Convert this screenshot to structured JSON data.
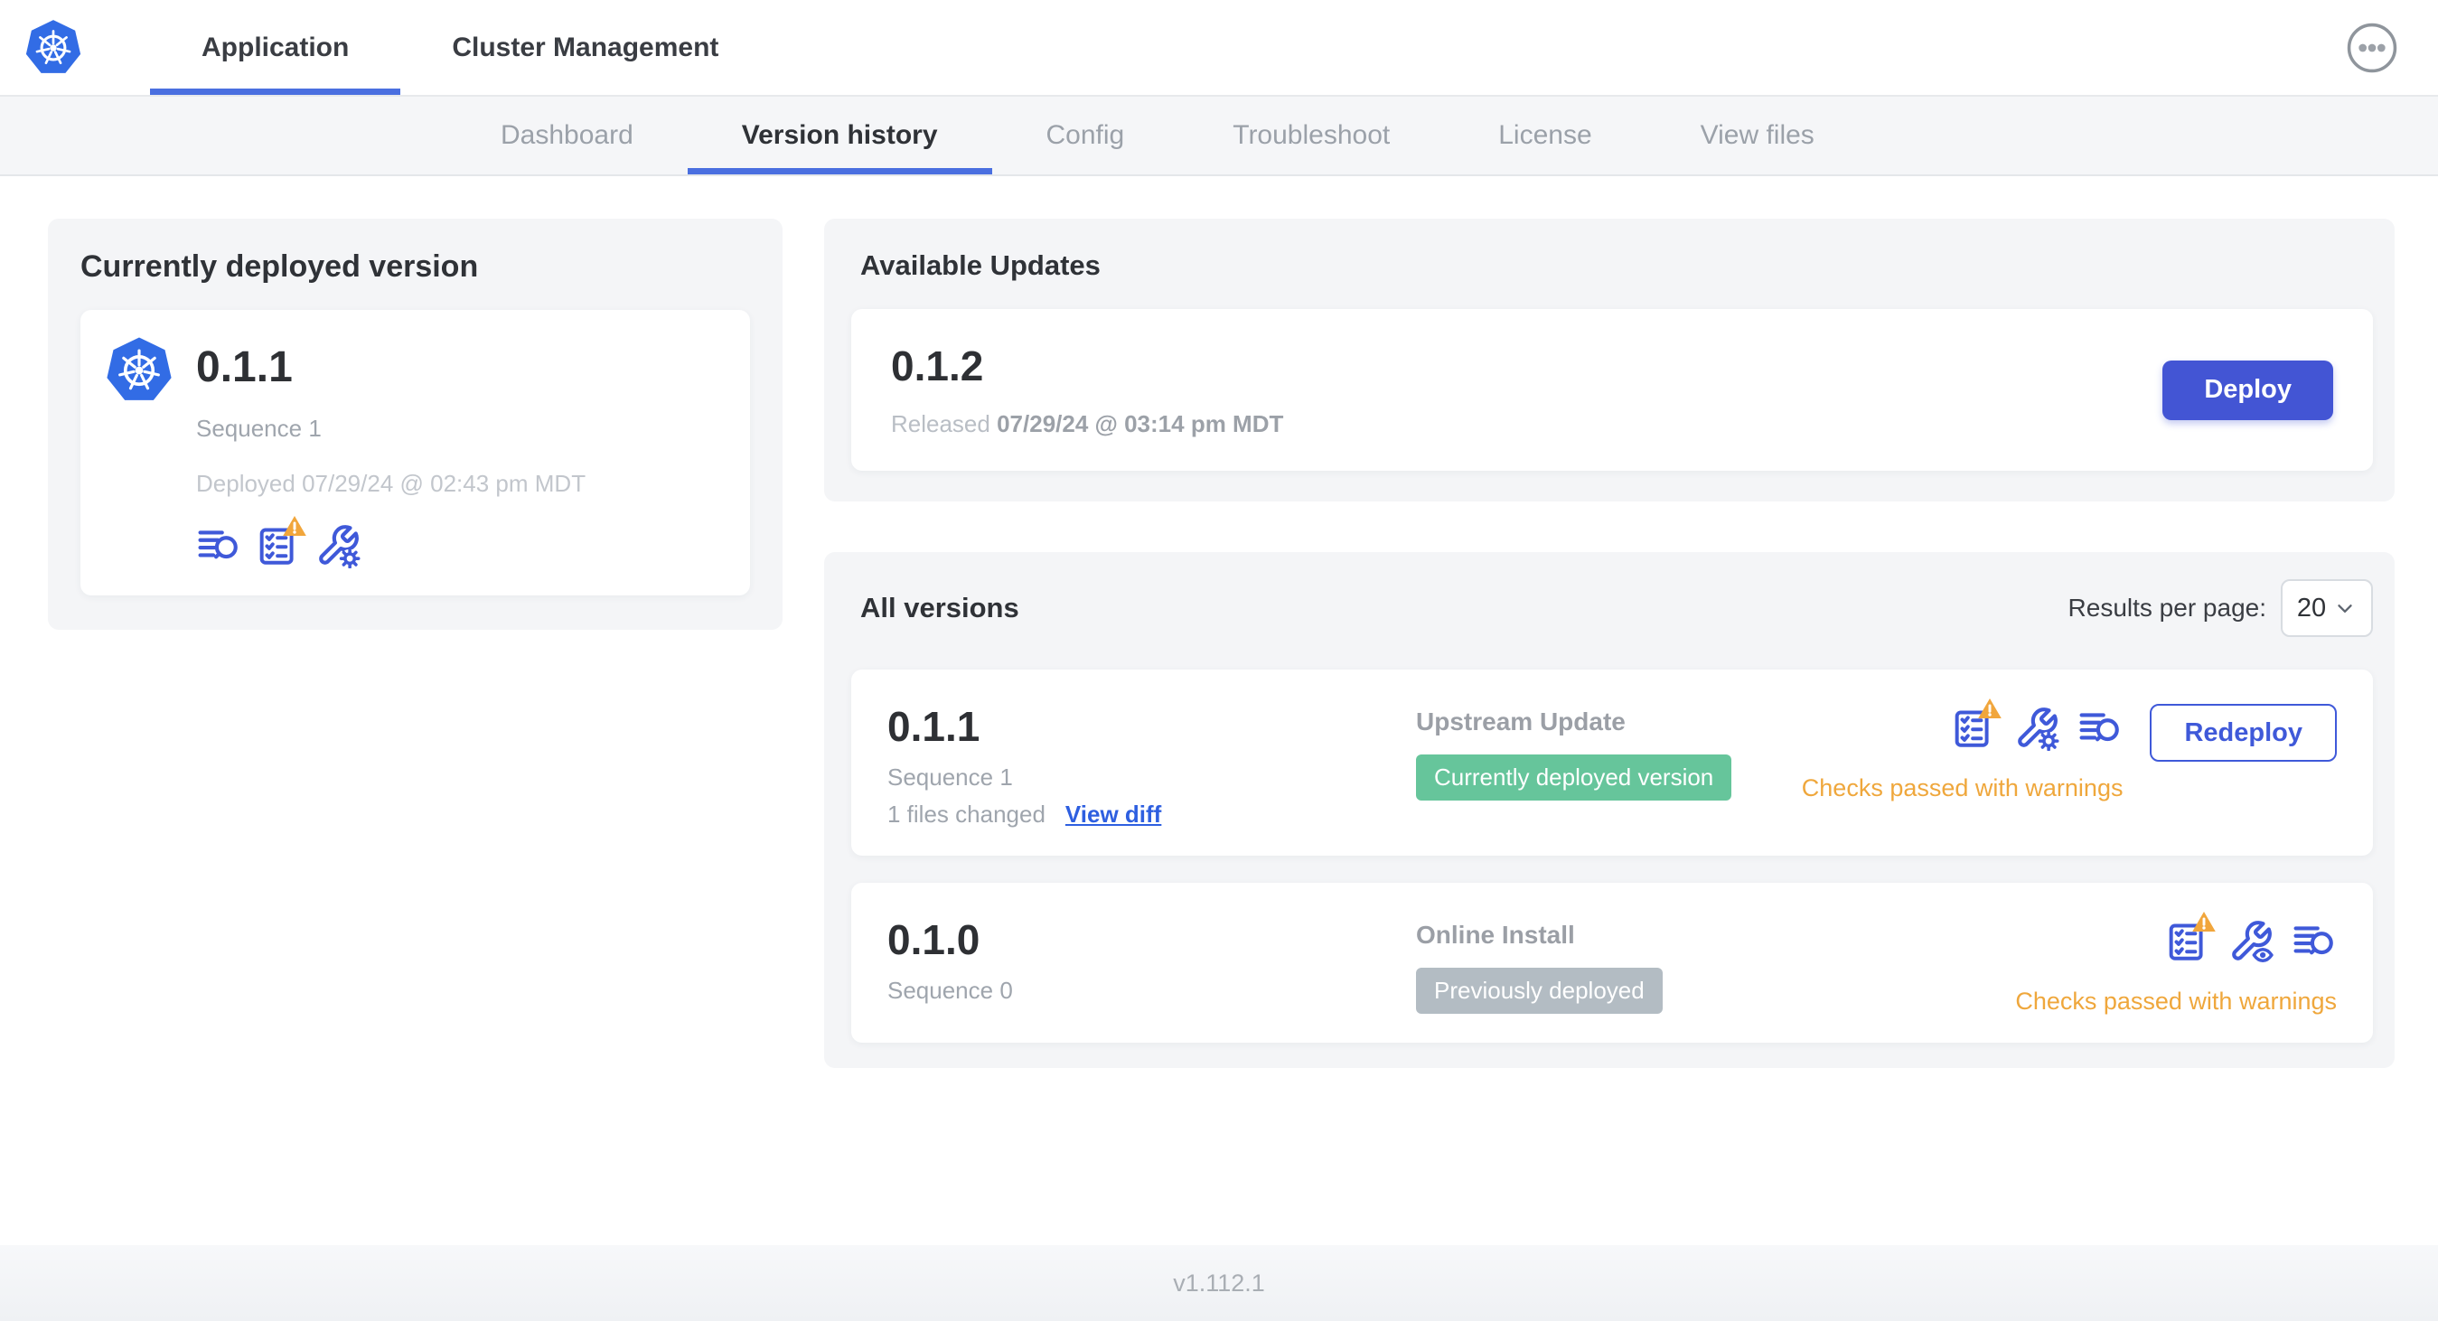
{
  "topnav": {
    "tabs": [
      {
        "label": "Application"
      },
      {
        "label": "Cluster Management"
      }
    ]
  },
  "subnav": {
    "tabs": [
      {
        "label": "Dashboard"
      },
      {
        "label": "Version history"
      },
      {
        "label": "Config"
      },
      {
        "label": "Troubleshoot"
      },
      {
        "label": "License"
      },
      {
        "label": "View files"
      }
    ]
  },
  "current": {
    "title": "Currently deployed version",
    "version": "0.1.1",
    "sequence": "Sequence 1",
    "deployed": "Deployed 07/29/24 @ 02:43 pm MDT",
    "icons": [
      "diff-lines-search-icon",
      "preflight-checklist-warning-icon",
      "wrench-gear-config-icon"
    ]
  },
  "available": {
    "title": "Available Updates",
    "version": "0.1.2",
    "released_prefix": "Released",
    "released_date": "07/29/24 @ 03:14 pm MDT",
    "deploy_label": "Deploy"
  },
  "all_versions": {
    "title": "All versions",
    "results_per_page_label": "Results per page:",
    "results_per_page_value": "20",
    "rows": [
      {
        "version": "0.1.1",
        "sequence": "Sequence 1",
        "files_changed": "1 files changed",
        "view_diff_label": "View diff",
        "source": "Upstream Update",
        "badge": "Currently deployed version",
        "badge_type": "success",
        "icons": [
          "preflight-checklist-warning-icon",
          "wrench-gear-config-icon",
          "diff-lines-search-icon"
        ],
        "action_label": "Redeploy",
        "status": "Checks passed with warnings"
      },
      {
        "version": "0.1.0",
        "sequence": "Sequence 0",
        "source": "Online Install",
        "badge": "Previously deployed",
        "badge_type": "muted",
        "icons": [
          "preflight-checklist-warning-icon",
          "wrench-eye-view-config-icon",
          "diff-lines-search-icon"
        ],
        "status": "Checks passed with warnings"
      }
    ]
  },
  "footer": {
    "app_version": "v1.112.1"
  },
  "colors": {
    "kubernetes_blue": "#326CE5",
    "primary_button_blue": "#4355D4",
    "icon_blue": "#3F59D9",
    "link_blue": "#2E5FE0",
    "active_tab_underline": "#4A6FE0",
    "success_badge_green": "#66C59B",
    "muted_badge_gray": "#B3BCC3",
    "warning_amber": "#EFA73C"
  }
}
